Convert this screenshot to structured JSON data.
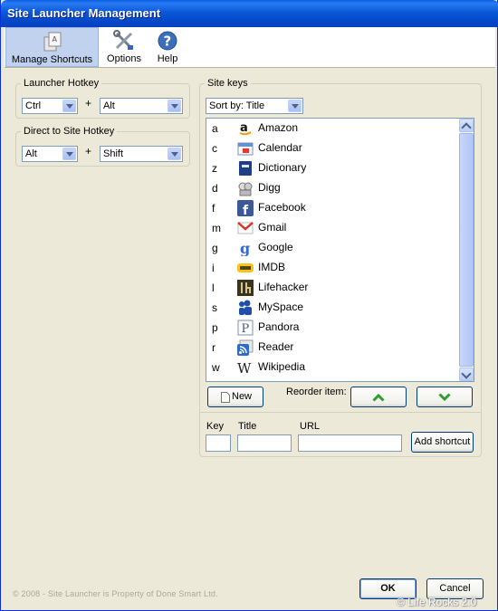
{
  "window": {
    "title": "Site Launcher Management"
  },
  "toolbar": {
    "manage_label": "Manage Shortcuts",
    "options_label": "Options",
    "help_label": "Help"
  },
  "launcher_hotkey": {
    "legend": "Launcher Hotkey",
    "modifier1": "Ctrl",
    "plus": "+",
    "modifier2": "Alt"
  },
  "direct_hotkey": {
    "legend": "Direct to Site Hotkey",
    "modifier1": "Alt",
    "plus": "+",
    "modifier2": "Shift"
  },
  "site_keys": {
    "legend": "Site keys",
    "sort": "Sort by: Title",
    "items": [
      {
        "key": "a",
        "title": "Amazon",
        "icon": "amazon-icon"
      },
      {
        "key": "c",
        "title": "Calendar",
        "icon": "calendar-icon"
      },
      {
        "key": "z",
        "title": "Dictionary",
        "icon": "dictionary-icon"
      },
      {
        "key": "d",
        "title": "Digg",
        "icon": "digg-icon"
      },
      {
        "key": "f",
        "title": "Facebook",
        "icon": "facebook-icon"
      },
      {
        "key": "m",
        "title": "Gmail",
        "icon": "gmail-icon"
      },
      {
        "key": "g",
        "title": "Google",
        "icon": "google-icon"
      },
      {
        "key": "i",
        "title": "IMDB",
        "icon": "imdb-icon"
      },
      {
        "key": "l",
        "title": "Lifehacker",
        "icon": "lifehacker-icon"
      },
      {
        "key": "s",
        "title": "MySpace",
        "icon": "myspace-icon"
      },
      {
        "key": "p",
        "title": "Pandora",
        "icon": "pandora-icon"
      },
      {
        "key": "r",
        "title": "Reader",
        "icon": "reader-icon"
      },
      {
        "key": "w",
        "title": "Wikipedia",
        "icon": "wikipedia-icon"
      }
    ],
    "new_label": "New",
    "reorder_label": "Reorder item:"
  },
  "add_form": {
    "key_label": "Key",
    "title_label": "Title",
    "url_label": "URL",
    "key_value": "",
    "title_value": "",
    "url_value": "",
    "add_label": "Add shortcut"
  },
  "footer": {
    "copyright": "© 2008 - Site Launcher is Property of Done Smart Ltd.",
    "ok_label": "OK",
    "cancel_label": "Cancel",
    "watermark": "© Life Rocks 2.0"
  },
  "colors": {
    "titlebar": "#0a58d8",
    "reorder_arrow": "#2e9e2e",
    "window_bg": "#ece9d8"
  }
}
